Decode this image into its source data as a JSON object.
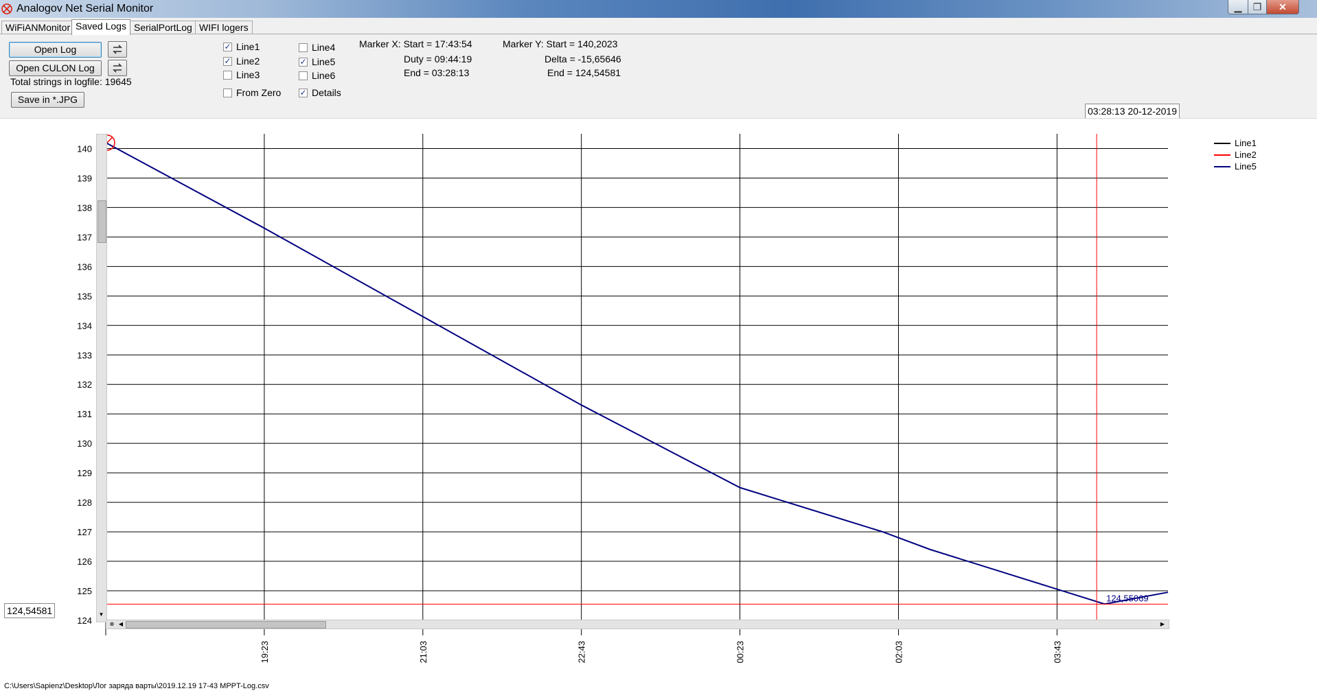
{
  "window": {
    "title": "Analogov Net Serial Monitor",
    "min_glyph": "▁",
    "max_glyph": "❐",
    "close_glyph": "✕"
  },
  "tabs": [
    {
      "label": "WiFiANMonitor",
      "active": false
    },
    {
      "label": "Saved Logs",
      "active": true
    },
    {
      "label": "SerialPortLog",
      "active": false
    },
    {
      "label": "WIFI logers",
      "active": false
    }
  ],
  "controls": {
    "open_log": "Open Log",
    "open_culon_log": "Open CULON Log",
    "total_strings": "Total strings in logfile: 19645",
    "save_jpg": "Save in *.JPG",
    "checkboxes": [
      {
        "label": "Line1",
        "checked": true
      },
      {
        "label": "Line2",
        "checked": true
      },
      {
        "label": "Line3",
        "checked": false
      },
      {
        "label": "Line4",
        "checked": false
      },
      {
        "label": "Line5",
        "checked": true
      },
      {
        "label": "Line6",
        "checked": false
      },
      {
        "label": "From Zero",
        "checked": false
      },
      {
        "label": "Details",
        "checked": true
      }
    ]
  },
  "markers": {
    "x_start": "Marker X: Start = 17:43:54",
    "x_duty": "Duty = 09:44:19",
    "x_end": "End  = 03:28:13",
    "y_start": "Marker Y: Start = 140,2023",
    "y_delta": "Delta = -15,65646",
    "y_end": "End  = 124,54581"
  },
  "cursor_time": "03:28:13 20-12-2019",
  "cursor_value": "124,54581",
  "status_path": "C:\\Users\\Sapienz\\Desktop\\Лог заряда варты\\2019.12.19 17-43 MPPT-Log.csv",
  "colors": {
    "line1": "#000000",
    "line2": "#ff0000",
    "line5": "#000080"
  },
  "chart_data": {
    "type": "line",
    "x_ticks": [
      "19:23",
      "21:03",
      "22:43",
      "00:23",
      "02:03",
      "03:43"
    ],
    "y_ticks": [
      124,
      125,
      126,
      127,
      128,
      129,
      130,
      131,
      132,
      133,
      134,
      135,
      136,
      137,
      138,
      139,
      140
    ],
    "ylim": [
      124,
      140.5
    ],
    "xlim_minutes": [
      1063,
      1733
    ],
    "legend": [
      "Line1",
      "Line2",
      "Line5"
    ],
    "legend_position": "top-right",
    "grid": true,
    "series": [
      {
        "name": "Line5",
        "x_minutes": [
          1063,
          1163,
          1263,
          1363,
          1463,
          1553,
          1583,
          1693,
          1733
        ],
        "values": [
          140.2,
          137.3,
          134.3,
          131.3,
          128.5,
          127.0,
          126.4,
          124.55,
          124.95
        ]
      }
    ],
    "marker_y_value": 124.54581,
    "marker_x_minutes": 1688,
    "marker_label": "124,55069"
  }
}
